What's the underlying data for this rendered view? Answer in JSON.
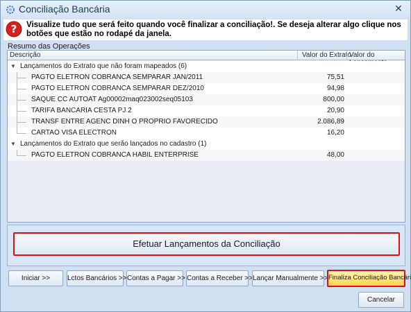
{
  "window": {
    "title": "Conciliação Bancária",
    "close_glyph": "✕"
  },
  "warning": {
    "icon": "question-mark-icon",
    "text": "Visualize tudo que será feito quando você finalizar a conciliação!. Se deseja alterar algo clique nos botões que estão no rodapé da janela."
  },
  "summary": {
    "label": "Resumo das Operações",
    "columns": [
      "Descrição",
      "Valor do Extrato",
      "Valor do Lançamento"
    ],
    "groups": [
      {
        "label": "Lançamentos do Extrato que não foram mapeados (6)",
        "items": [
          {
            "desc": "PAGTO ELETRON  COBRANCA SEMPARAR JAN/2011",
            "value": "75,51"
          },
          {
            "desc": "PAGTO ELETRON  COBRANCA SEMPARAR DEZ/2010",
            "value": "94,98"
          },
          {
            "desc": "SAQUE CC AUTOAT Ag00002maq023002seq05103",
            "value": "800,00"
          },
          {
            "desc": "TARIFA BANCARIA CESTA PJ 2",
            "value": "20,90"
          },
          {
            "desc": "TRANSF ENTRE AGENC DINH O PROPRIO FAVORECIDO",
            "value": "2.086,89"
          },
          {
            "desc": "CARTAO VISA ELECTRON",
            "value": "16,20"
          }
        ]
      },
      {
        "label": "Lançamentos do Extrato que serão lançados no cadastro (1)",
        "items": [
          {
            "desc": "PAGTO ELETRON  COBRANCA HABIL ENTERPRISE",
            "value": "48,00"
          }
        ]
      }
    ]
  },
  "actions": {
    "execute_label": "Efetuar Lançamentos da Conciliação",
    "footer_buttons": [
      "Iniciar >>",
      "Lctos Bancários >>",
      "Contas a Pagar >>",
      "Contas a Receber >>",
      "Lançar Manualmente >>",
      "Finaliza Conciliação Bancária"
    ],
    "cancel_label": "Cancelar"
  },
  "colors": {
    "highlight_border": "#e01010",
    "highlight_fill": "#ffd24d",
    "window_bg": "#cfe0f3"
  }
}
